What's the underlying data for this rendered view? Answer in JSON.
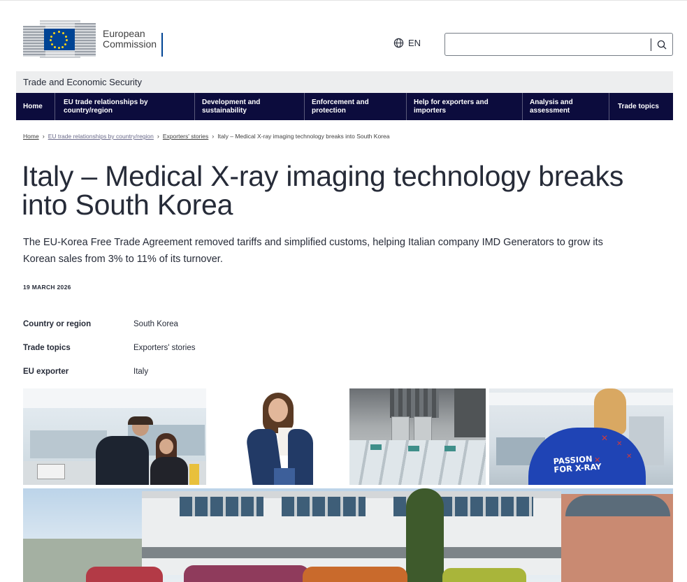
{
  "header": {
    "logo": {
      "line1": "European",
      "line2": "Commission"
    },
    "language": {
      "code": "EN",
      "icon": "globe-icon"
    },
    "search": {
      "placeholder": "",
      "value": "",
      "icon": "search-icon"
    }
  },
  "site_name": "Trade and Economic Security",
  "nav": {
    "items": [
      {
        "label": "Home"
      },
      {
        "label": "EU trade relationships by country/region"
      },
      {
        "label": "Development and sustainability"
      },
      {
        "label": "Enforcement and protection"
      },
      {
        "label": "Help for exporters and importers"
      },
      {
        "label": "Analysis and assessment"
      },
      {
        "label": "Trade topics"
      }
    ]
  },
  "breadcrumb": {
    "items": [
      {
        "label": "Home"
      },
      {
        "label": "EU trade relationships by country/region"
      },
      {
        "label": "Exporters' stories"
      },
      {
        "label": "Italy – Medical X-ray imaging technology breaks into South Korea"
      }
    ]
  },
  "article": {
    "title": "Italy – Medical X-ray imaging technology breaks into South Korea",
    "lead": "The EU-Korea Free Trade Agreement removed tariffs and simplified customs, helping Italian company IMD Generators to grow its Korean sales from 3% to 11% of its turnover.",
    "date": "19 MARCH 2026",
    "meta": [
      {
        "label": "Country or region",
        "value": "South Korea"
      },
      {
        "label": "Trade topics",
        "value": "Exporters' stories"
      },
      {
        "label": "EU exporter",
        "value": "Italy"
      }
    ],
    "photo_text_line1": "PASSION",
    "photo_text_line2": "FOR X-RAY"
  },
  "colors": {
    "nav_bg": "#0c0c3d",
    "site_bar_bg": "#edeeef",
    "eu_blue": "#004494",
    "eu_yellow": "#ffd617",
    "jacket_blue": "#1f44b5"
  }
}
